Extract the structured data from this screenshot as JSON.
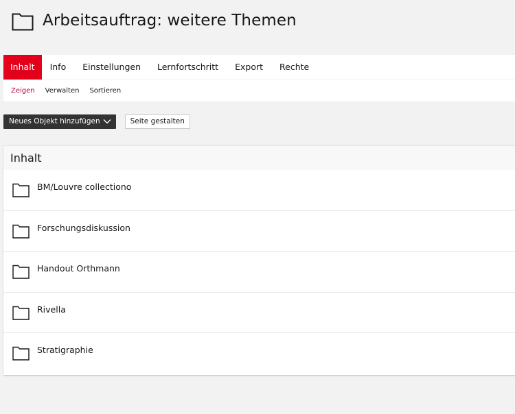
{
  "header": {
    "icon": "folder-icon",
    "title": "Arbeitsauftrag: weitere Themen"
  },
  "tabs": [
    {
      "label": "Inhalt",
      "active": true
    },
    {
      "label": "Info",
      "active": false
    },
    {
      "label": "Einstellungen",
      "active": false
    },
    {
      "label": "Lernfortschritt",
      "active": false
    },
    {
      "label": "Export",
      "active": false
    },
    {
      "label": "Rechte",
      "active": false
    }
  ],
  "subtabs": [
    {
      "label": "Zeigen",
      "active": true
    },
    {
      "label": "Verwalten",
      "active": false
    },
    {
      "label": "Sortieren",
      "active": false
    }
  ],
  "toolbar": {
    "add_object_label": "Neues Objekt hinzufügen",
    "add_object_icon": "chevron-down-icon",
    "design_page_label": "Seite gestalten"
  },
  "content": {
    "heading": "Inhalt",
    "items": [
      {
        "title": "BM/Louvre collectiono",
        "icon": "folder-icon"
      },
      {
        "title": "Forschungsdiskussion",
        "icon": "folder-icon"
      },
      {
        "title": "Handout Orthmann",
        "icon": "folder-icon"
      },
      {
        "title": "Rivella",
        "icon": "folder-icon"
      },
      {
        "title": "Stratigraphie",
        "icon": "folder-icon"
      }
    ]
  },
  "colors": {
    "accent": "#e2001a",
    "subtab_active": "#c2003c",
    "dark_button": "#333333",
    "background": "#f2f2f2"
  }
}
